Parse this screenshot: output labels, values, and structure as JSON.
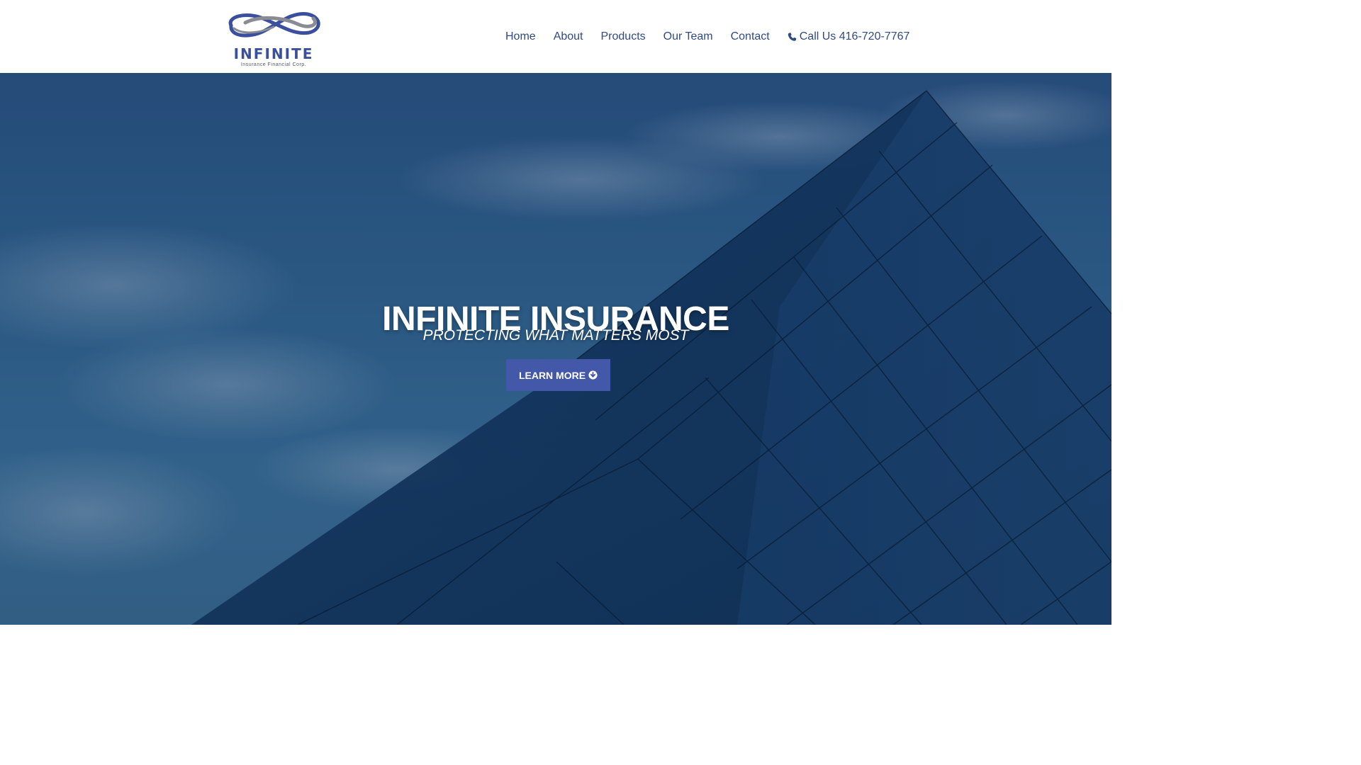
{
  "brand": {
    "logo_word": "INFINITE",
    "logo_sub": "Insurance Financial Corp.",
    "logo_icon": "infinity-logo-icon",
    "color_primary": "#3a4f9e",
    "color_nav": "#2f4a86"
  },
  "nav": {
    "items": [
      {
        "label": "Home"
      },
      {
        "label": "About"
      },
      {
        "label": "Products"
      },
      {
        "label": "Our Team"
      },
      {
        "label": "Contact"
      }
    ],
    "call_label": "Call Us 416-720-7767",
    "call_icon": "phone-icon"
  },
  "hero": {
    "title": "INFINITE INSURANCE",
    "tagline": "PROTECTING WHAT MATTERS MOST",
    "cta_label": "LEARN MORE",
    "cta_icon": "arrow-circle-down-icon",
    "cta_color": "#4358a8"
  }
}
